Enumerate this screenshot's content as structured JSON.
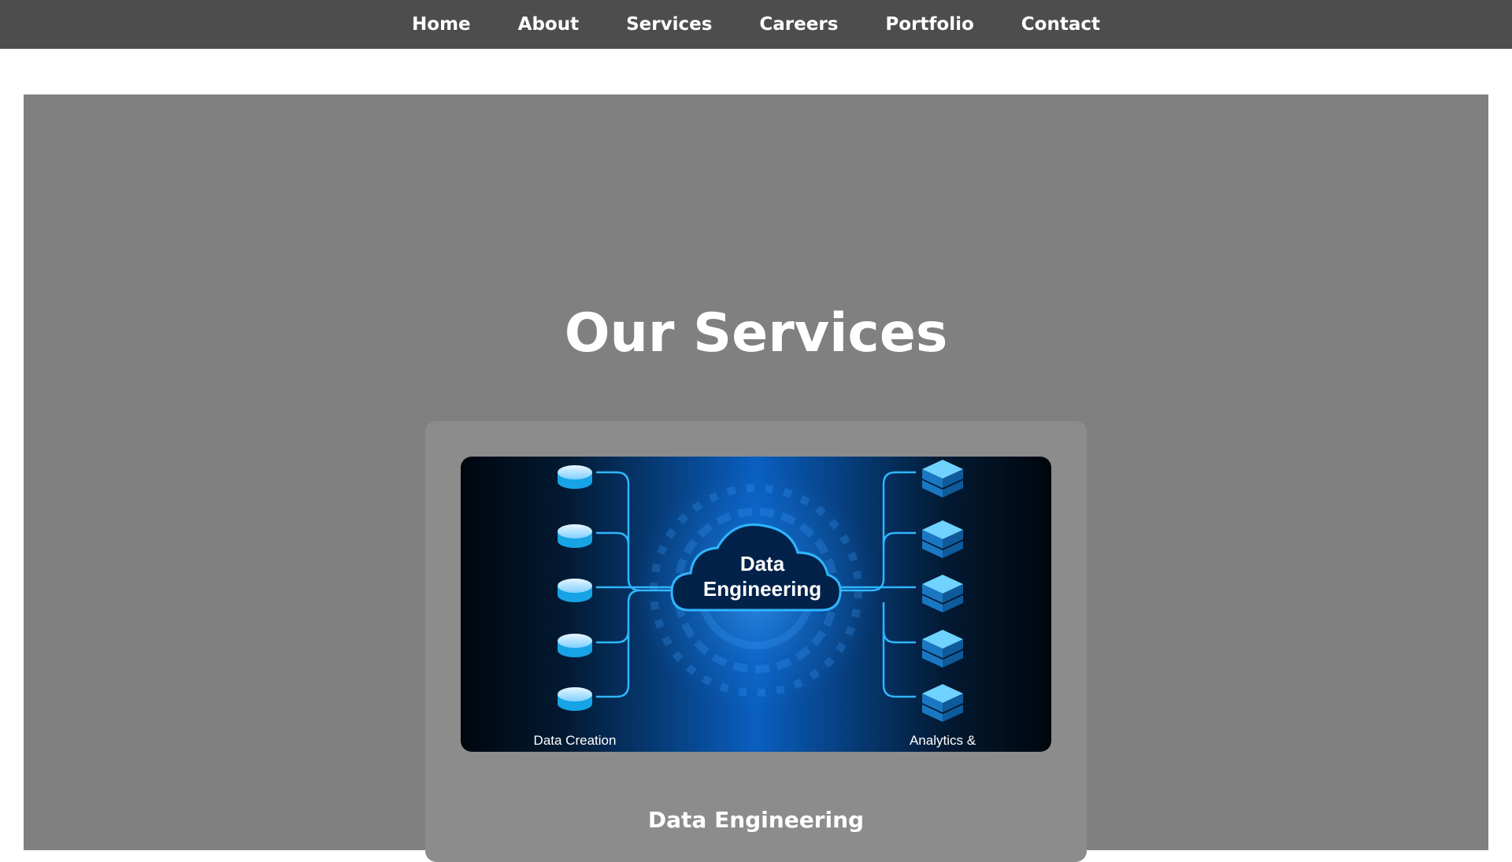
{
  "nav": {
    "items": [
      {
        "label": "Home"
      },
      {
        "label": "About"
      },
      {
        "label": "Services"
      },
      {
        "label": "Careers"
      },
      {
        "label": "Portfolio"
      },
      {
        "label": "Contact"
      }
    ]
  },
  "services": {
    "title": "Our Services",
    "cards": [
      {
        "title": "Data Engineering",
        "image": {
          "center_label_line1": "Data",
          "center_label_line2": "Engineering",
          "left_caption": "Data Creation",
          "right_caption": "Analytics &",
          "icon_left": "database-icon",
          "icon_right": "server-stack-icon"
        }
      }
    ]
  },
  "colors": {
    "nav_bg": "#4d4d4d",
    "section_bg": "#808080",
    "card_bg": "#8c8c8c",
    "image_accent": "#1e90ff"
  }
}
